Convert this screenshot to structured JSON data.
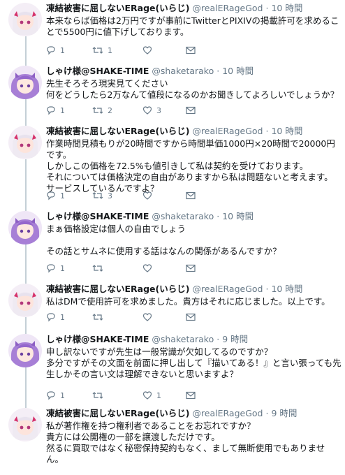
{
  "tweets": [
    {
      "name": "凍結被害に屈しないERage(いらじ)",
      "handle": "@realERageGod",
      "dot": "·",
      "time": "10 時間",
      "text": "本来ならば価格は2万円ですが事前にTwitterとPIXIVの掲載許可を求めることで5500円に値下げしております。",
      "reply": "1",
      "retweet": "1",
      "like": ""
    },
    {
      "name": "しゃけ様@SHAKE-TIME",
      "handle": "@shaketarako",
      "dot": "·",
      "time": "10 時間",
      "text": "先生そろそろ現実見てください\n何をどうしたら2万なんて値段になるのかお聞きしてよろしいでしょうか？",
      "reply": "1",
      "retweet": "2",
      "like": "3"
    },
    {
      "name": "凍結被害に屈しないERage(いらじ)",
      "handle": "@realERageGod",
      "dot": "·",
      "time": "10 時間",
      "text": "作業時間見積もりが20時間ですから時間単価1000円×20時間で20000円です。\nしかしこの価格を72.5%も値引きして私は契約を受けております。\nそれについては価格決定の自由がありますから私は問題ないと考えます。\nサービスしているんですよ？",
      "reply": "1",
      "retweet": "3",
      "like": ""
    },
    {
      "name": "しゃけ様@SHAKE-TIME",
      "handle": "@shaketarako",
      "dot": "·",
      "time": "10 時間",
      "text": "まぁ価格設定は個人の自由でしょう\n\nその話とサムネに使用する話はなんの関係があるんですか？",
      "reply": "1",
      "retweet": "",
      "like": ""
    },
    {
      "name": "凍結被害に屈しないERage(いらじ)",
      "handle": "@realERageGod",
      "dot": "·",
      "time": "10 時間",
      "text": "私はDMで使用許可を求めました。貴方はそれに応じました。以上です。",
      "reply": "1",
      "retweet": "",
      "like": ""
    },
    {
      "name": "しゃけ様@SHAKE-TIME",
      "handle": "@shaketarako",
      "dot": "·",
      "time": "9 時間",
      "text": "申し訳ないですが先生は一般常識が欠如してるのですか？\n多分ですがその文面を前面に押し出して『描いてある！』と言い張っても先生しかその言い文は理解できないと思いますよ？",
      "reply": "1",
      "retweet": "",
      "like": "1"
    },
    {
      "name": "凍結被害に屈しないERage(いらじ)",
      "handle": "@realERageGod",
      "dot": "·",
      "time": "9 時間",
      "text": "私が著作権を持つ権利者であることをお忘れですか？\n貴方には公開権の一部を譲渡しただけです。\n然るに買取ではなく秘密保持契約もなく、まして無断使用でもありません。",
      "reply": "",
      "retweet": "",
      "like": ""
    }
  ],
  "icons": {
    "reply": "reply-icon",
    "retweet": "retweet-icon",
    "like": "heart-icon",
    "dm": "envelope-icon"
  }
}
